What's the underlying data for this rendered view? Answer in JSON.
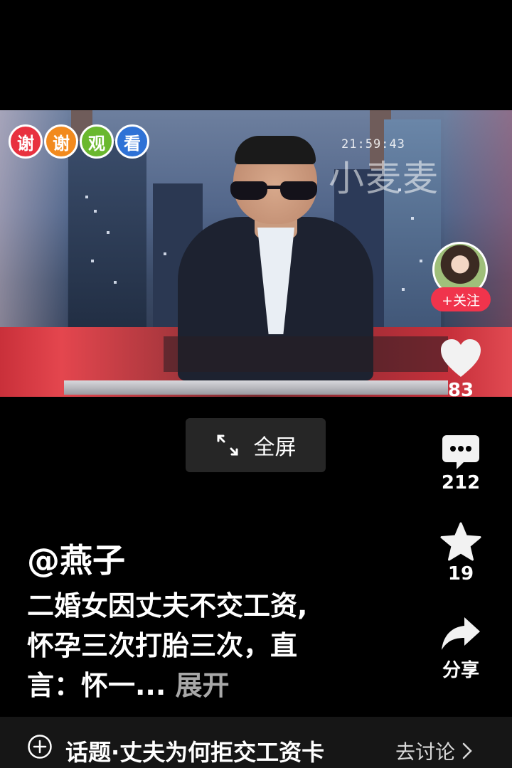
{
  "video": {
    "badges": [
      {
        "char": "谢",
        "color": "#e8313f"
      },
      {
        "char": "谢",
        "color": "#f28a1e"
      },
      {
        "char": "观",
        "color": "#6ab82e"
      },
      {
        "char": "看",
        "color": "#2f72d6"
      }
    ],
    "timestamp": "21:59:43",
    "watermark": "小麦麦"
  },
  "fullscreen": {
    "label": "全屏"
  },
  "follow": {
    "label": "+关注"
  },
  "actions": {
    "like_count": "83",
    "comment_count": "212",
    "favorite_count": "19",
    "share_label": "分享"
  },
  "caption": {
    "author": "@燕子",
    "line1": "二婚女因丈夫不交工资,",
    "line2": "怀孕三次打胎三次，直",
    "line3": "言：怀一...",
    "expand": "展开"
  },
  "topic": {
    "text": "话题·丈夫为何拒交工资卡",
    "action": "去讨论"
  },
  "colors": {
    "follow_red": "#f0344c",
    "background": "#000000"
  }
}
